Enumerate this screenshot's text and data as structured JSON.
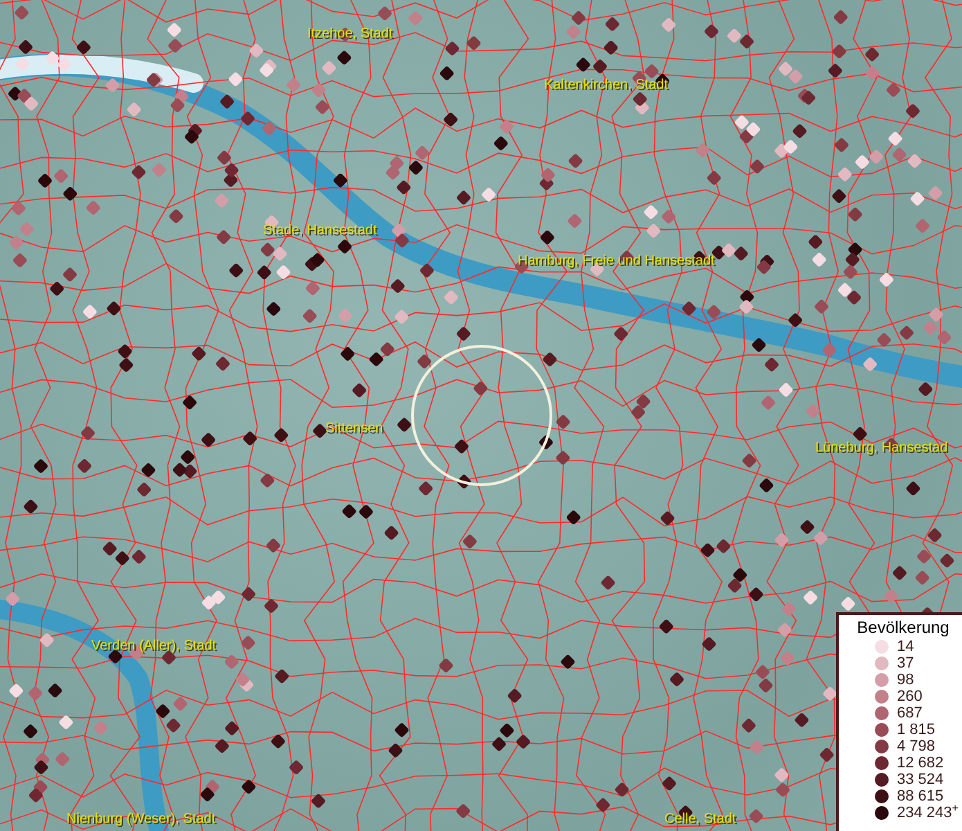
{
  "map": {
    "place_labels": [
      {
        "name": "Itzehoe, Stadt"
      },
      {
        "name": "Kaltenkirchen, Stadt"
      },
      {
        "name": "Stade, Hansestadt"
      },
      {
        "name": "Hamburg, Freie und Hansestadt"
      },
      {
        "name": "Sittensen"
      },
      {
        "name": "Lüneburg, Hansestad"
      },
      {
        "name": "Verden (Aller), Stadt"
      },
      {
        "name": "Nienburg (Weser), Stadt"
      },
      {
        "name": "Celle, Stadt"
      }
    ]
  },
  "legend": {
    "title": "Bevölkerung",
    "entries": [
      {
        "label": "14",
        "color": "#f5dde3"
      },
      {
        "label": "37",
        "color": "#e3b9c1"
      },
      {
        "label": "98",
        "color": "#d49ea8"
      },
      {
        "label": "260",
        "color": "#c2808a"
      },
      {
        "label": "687",
        "color": "#b06570"
      },
      {
        "label": "1 815",
        "color": "#9a4c56"
      },
      {
        "label": "4 798",
        "color": "#843a43"
      },
      {
        "label": "12 682",
        "color": "#6e2831"
      },
      {
        "label": "33 524",
        "color": "#561a22"
      },
      {
        "label": "88 615",
        "color": "#3e1015"
      },
      {
        "label": "234 243$^{+}$",
        "color": "#2a080c"
      }
    ]
  }
}
